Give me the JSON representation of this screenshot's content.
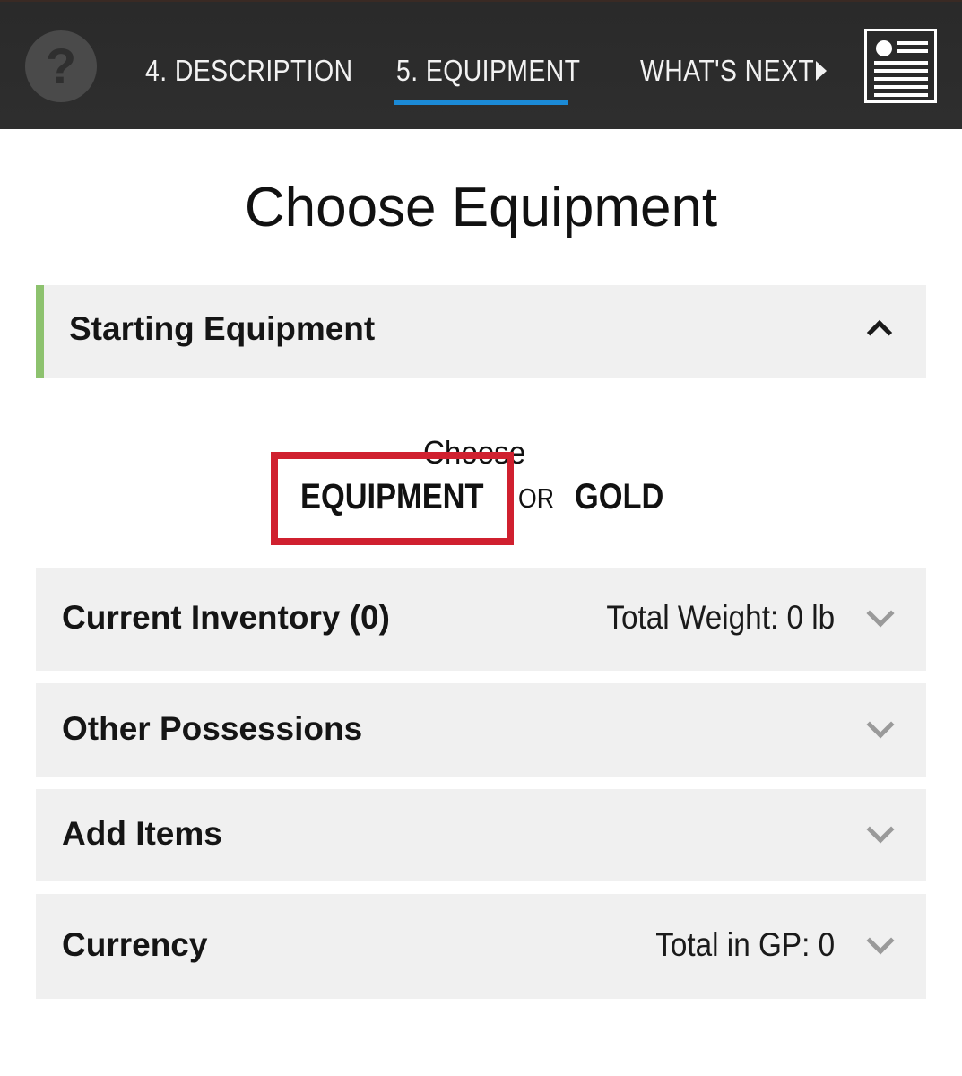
{
  "nav": {
    "help_glyph": "?",
    "tabs": [
      {
        "label": "4. DESCRIPTION"
      },
      {
        "label": "5. EQUIPMENT"
      },
      {
        "label": "WHAT'S NEXT"
      }
    ],
    "active_tab": "5. EQUIPMENT",
    "accent_color": "#1b8ad6",
    "icons": {
      "help": "question-icon",
      "next": "triangle-right-icon",
      "sheet": "character-sheet-icon"
    }
  },
  "page": {
    "title": "Choose Equipment"
  },
  "starting_equipment": {
    "title": "Starting Equipment",
    "expanded": true,
    "accent_color": "#8dc26e",
    "choose_label": "Choose",
    "option_equipment": "EQUIPMENT",
    "option_or": "OR",
    "option_gold": "GOLD",
    "highlight_color": "#d0202f"
  },
  "sections": {
    "inventory": {
      "title": "Current Inventory (0)",
      "meta": "Total Weight: 0 lb"
    },
    "other": {
      "title": "Other Possessions"
    },
    "add_items": {
      "title": "Add Items"
    },
    "currency": {
      "title": "Currency",
      "meta": "Total in GP: 0"
    }
  }
}
